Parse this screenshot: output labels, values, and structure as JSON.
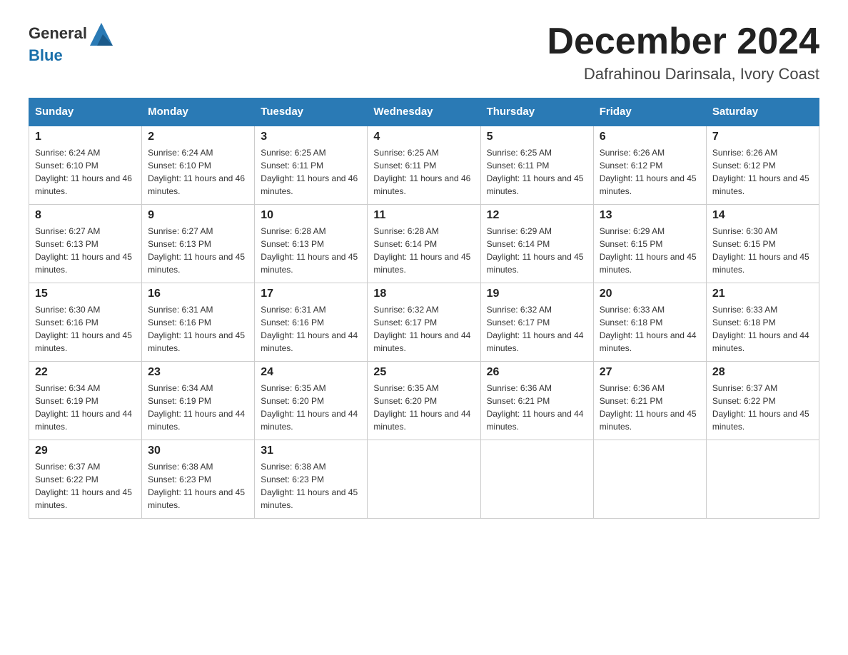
{
  "header": {
    "logo_text_general": "General",
    "logo_text_blue": "Blue",
    "month_title": "December 2024",
    "location": "Dafrahinou Darinsala, Ivory Coast"
  },
  "days_of_week": [
    "Sunday",
    "Monday",
    "Tuesday",
    "Wednesday",
    "Thursday",
    "Friday",
    "Saturday"
  ],
  "weeks": [
    [
      {
        "day": "1",
        "sunrise": "6:24 AM",
        "sunset": "6:10 PM",
        "daylight": "11 hours and 46 minutes."
      },
      {
        "day": "2",
        "sunrise": "6:24 AM",
        "sunset": "6:10 PM",
        "daylight": "11 hours and 46 minutes."
      },
      {
        "day": "3",
        "sunrise": "6:25 AM",
        "sunset": "6:11 PM",
        "daylight": "11 hours and 46 minutes."
      },
      {
        "day": "4",
        "sunrise": "6:25 AM",
        "sunset": "6:11 PM",
        "daylight": "11 hours and 46 minutes."
      },
      {
        "day": "5",
        "sunrise": "6:25 AM",
        "sunset": "6:11 PM",
        "daylight": "11 hours and 45 minutes."
      },
      {
        "day": "6",
        "sunrise": "6:26 AM",
        "sunset": "6:12 PM",
        "daylight": "11 hours and 45 minutes."
      },
      {
        "day": "7",
        "sunrise": "6:26 AM",
        "sunset": "6:12 PM",
        "daylight": "11 hours and 45 minutes."
      }
    ],
    [
      {
        "day": "8",
        "sunrise": "6:27 AM",
        "sunset": "6:13 PM",
        "daylight": "11 hours and 45 minutes."
      },
      {
        "day": "9",
        "sunrise": "6:27 AM",
        "sunset": "6:13 PM",
        "daylight": "11 hours and 45 minutes."
      },
      {
        "day": "10",
        "sunrise": "6:28 AM",
        "sunset": "6:13 PM",
        "daylight": "11 hours and 45 minutes."
      },
      {
        "day": "11",
        "sunrise": "6:28 AM",
        "sunset": "6:14 PM",
        "daylight": "11 hours and 45 minutes."
      },
      {
        "day": "12",
        "sunrise": "6:29 AM",
        "sunset": "6:14 PM",
        "daylight": "11 hours and 45 minutes."
      },
      {
        "day": "13",
        "sunrise": "6:29 AM",
        "sunset": "6:15 PM",
        "daylight": "11 hours and 45 minutes."
      },
      {
        "day": "14",
        "sunrise": "6:30 AM",
        "sunset": "6:15 PM",
        "daylight": "11 hours and 45 minutes."
      }
    ],
    [
      {
        "day": "15",
        "sunrise": "6:30 AM",
        "sunset": "6:16 PM",
        "daylight": "11 hours and 45 minutes."
      },
      {
        "day": "16",
        "sunrise": "6:31 AM",
        "sunset": "6:16 PM",
        "daylight": "11 hours and 45 minutes."
      },
      {
        "day": "17",
        "sunrise": "6:31 AM",
        "sunset": "6:16 PM",
        "daylight": "11 hours and 44 minutes."
      },
      {
        "day": "18",
        "sunrise": "6:32 AM",
        "sunset": "6:17 PM",
        "daylight": "11 hours and 44 minutes."
      },
      {
        "day": "19",
        "sunrise": "6:32 AM",
        "sunset": "6:17 PM",
        "daylight": "11 hours and 44 minutes."
      },
      {
        "day": "20",
        "sunrise": "6:33 AM",
        "sunset": "6:18 PM",
        "daylight": "11 hours and 44 minutes."
      },
      {
        "day": "21",
        "sunrise": "6:33 AM",
        "sunset": "6:18 PM",
        "daylight": "11 hours and 44 minutes."
      }
    ],
    [
      {
        "day": "22",
        "sunrise": "6:34 AM",
        "sunset": "6:19 PM",
        "daylight": "11 hours and 44 minutes."
      },
      {
        "day": "23",
        "sunrise": "6:34 AM",
        "sunset": "6:19 PM",
        "daylight": "11 hours and 44 minutes."
      },
      {
        "day": "24",
        "sunrise": "6:35 AM",
        "sunset": "6:20 PM",
        "daylight": "11 hours and 44 minutes."
      },
      {
        "day": "25",
        "sunrise": "6:35 AM",
        "sunset": "6:20 PM",
        "daylight": "11 hours and 44 minutes."
      },
      {
        "day": "26",
        "sunrise": "6:36 AM",
        "sunset": "6:21 PM",
        "daylight": "11 hours and 44 minutes."
      },
      {
        "day": "27",
        "sunrise": "6:36 AM",
        "sunset": "6:21 PM",
        "daylight": "11 hours and 45 minutes."
      },
      {
        "day": "28",
        "sunrise": "6:37 AM",
        "sunset": "6:22 PM",
        "daylight": "11 hours and 45 minutes."
      }
    ],
    [
      {
        "day": "29",
        "sunrise": "6:37 AM",
        "sunset": "6:22 PM",
        "daylight": "11 hours and 45 minutes."
      },
      {
        "day": "30",
        "sunrise": "6:38 AM",
        "sunset": "6:23 PM",
        "daylight": "11 hours and 45 minutes."
      },
      {
        "day": "31",
        "sunrise": "6:38 AM",
        "sunset": "6:23 PM",
        "daylight": "11 hours and 45 minutes."
      },
      null,
      null,
      null,
      null
    ]
  ]
}
